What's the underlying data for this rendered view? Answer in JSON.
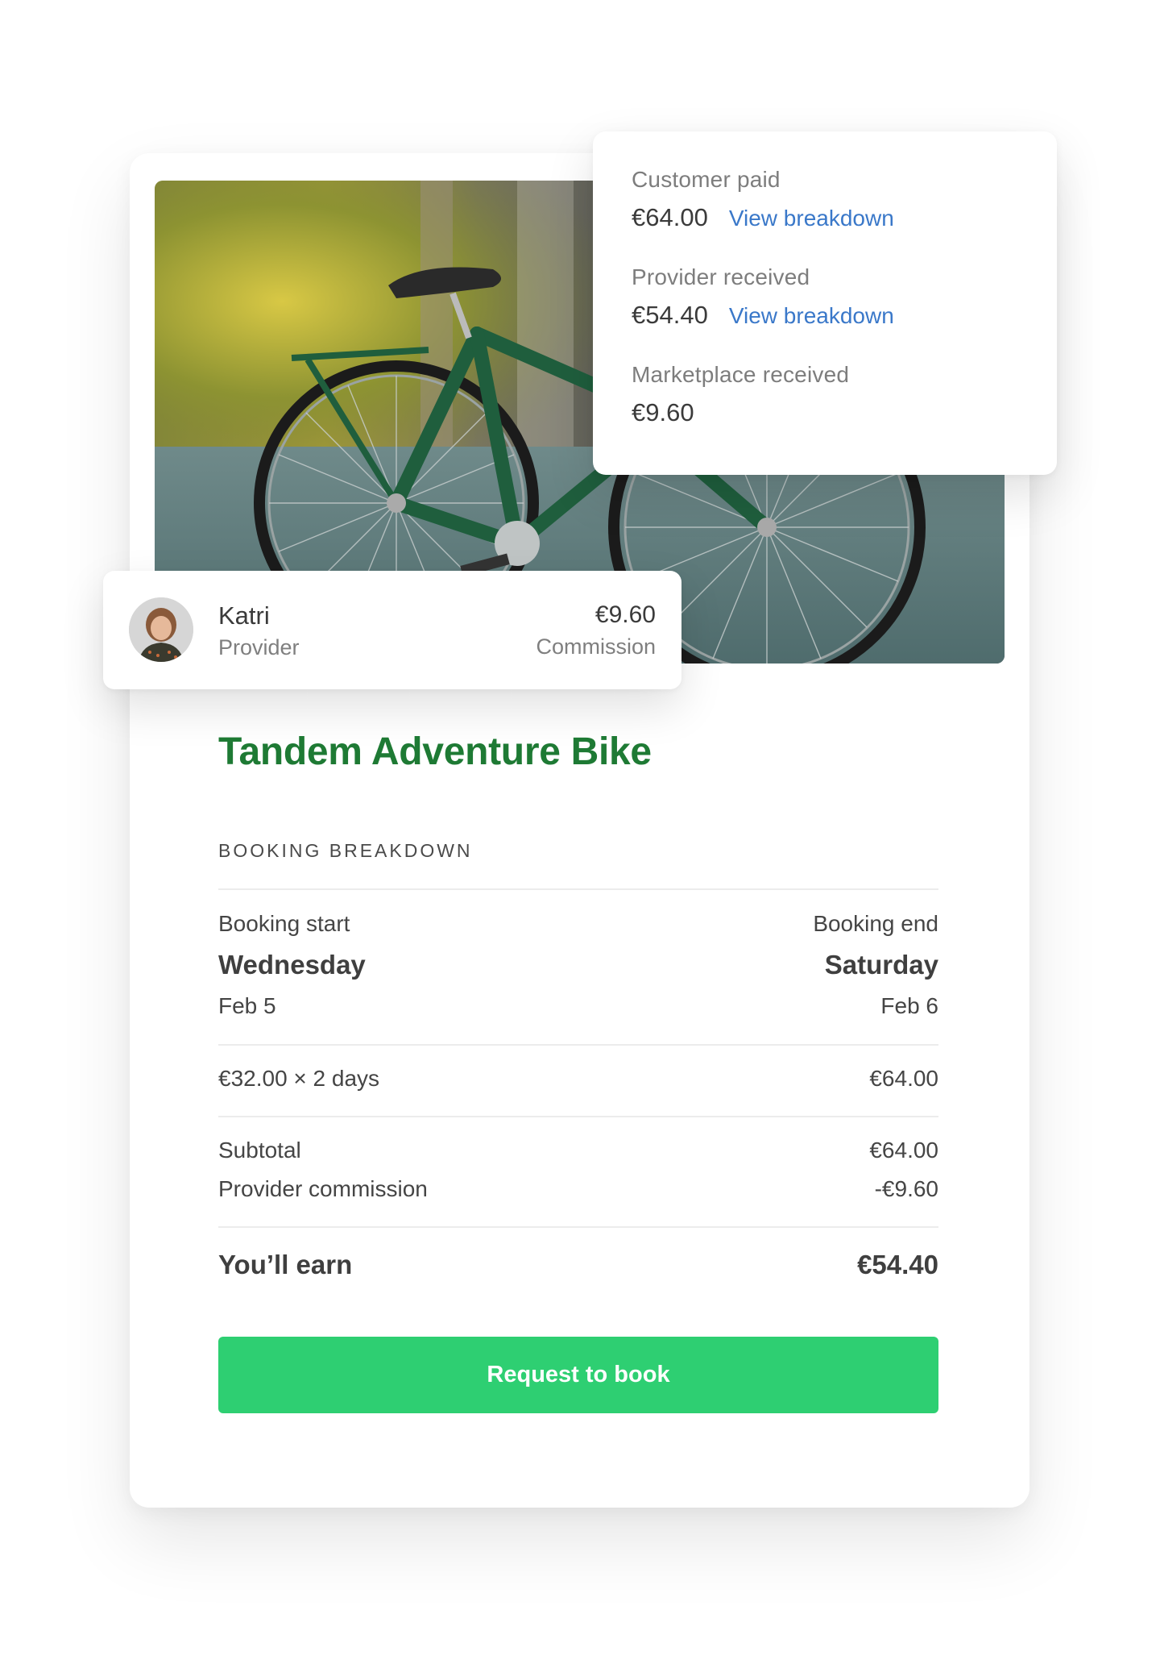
{
  "payout_summary": {
    "customer_paid": {
      "label": "Customer paid",
      "amount": "€64.00",
      "link": "View breakdown"
    },
    "provider_received": {
      "label": "Provider received",
      "amount": "€54.40",
      "link": "View breakdown"
    },
    "marketplace_received": {
      "label": "Marketplace received",
      "amount": "€9.60"
    }
  },
  "provider": {
    "name": "Katri",
    "role": "Provider",
    "commission_amount": "€9.60",
    "commission_label": "Commission"
  },
  "listing": {
    "title": "Tandem Adventure Bike",
    "image": "green-bicycle-photo"
  },
  "booking": {
    "heading": "BOOKING BREAKDOWN",
    "start_label": "Booking start",
    "start_day": "Wednesday",
    "start_date": "Feb 5",
    "end_label": "Booking end",
    "end_day": "Saturday",
    "end_date": "Feb 6",
    "line_item_label": "€32.00 × 2 days",
    "line_item_total": "€64.00",
    "subtotal_label": "Subtotal",
    "subtotal_value": "€64.00",
    "commission_label": "Provider commission",
    "commission_value": "-€9.60",
    "earn_label": "You’ll earn",
    "earn_value": "€54.40"
  },
  "cta": {
    "label": "Request to book"
  },
  "colors": {
    "title_green": "#1e7a34",
    "button_green": "#2ecf72",
    "link_blue": "#3a78c9"
  }
}
